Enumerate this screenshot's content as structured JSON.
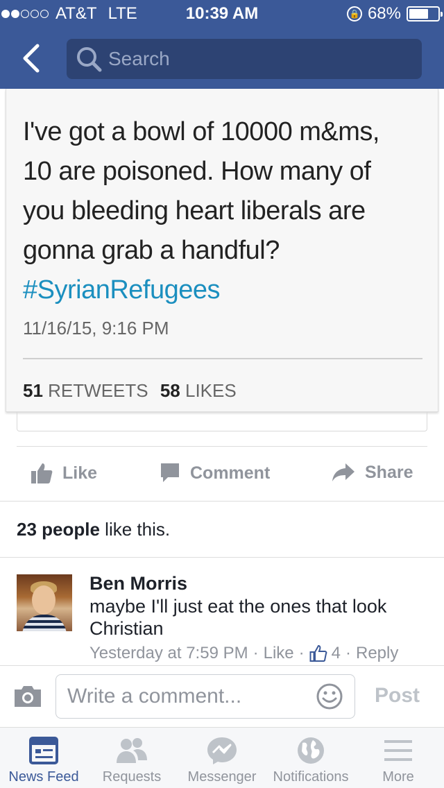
{
  "status_bar": {
    "carrier": "AT&T",
    "network": "LTE",
    "time": "10:39 AM",
    "battery": "68%",
    "signal_bars_filled": 2,
    "signal_bars_total": 5,
    "battery_level": 0.68
  },
  "header": {
    "search_placeholder": "Search"
  },
  "tweet": {
    "text_lines": [
      "I've got a bowl of 10000 m&ms,",
      "10 are poisoned.  How many of",
      "you bleeding heart liberals are",
      "gonna grab a handful?"
    ],
    "hashtag": "#SyrianRefugees",
    "date": "11/16/15, 9:16 PM",
    "retweets_count": "51",
    "retweets_label": "RETWEETS",
    "likes_count": "58",
    "likes_label": "LIKES"
  },
  "actions": {
    "like": "Like",
    "comment": "Comment",
    "share": "Share"
  },
  "likes_summary": {
    "count": "23 people",
    "suffix": " like this."
  },
  "comment": {
    "author": "Ben Morris",
    "text": "maybe I'll just eat the ones that look Christian",
    "time": "Yesterday at 7:59 PM",
    "like": "Like",
    "like_count": "4",
    "reply": "Reply"
  },
  "composer": {
    "placeholder": "Write a comment...",
    "post": "Post"
  },
  "tabs": [
    {
      "label": "News Feed",
      "icon": "news-feed-icon",
      "active": true
    },
    {
      "label": "Requests",
      "icon": "requests-icon",
      "active": false
    },
    {
      "label": "Messenger",
      "icon": "messenger-icon",
      "active": false
    },
    {
      "label": "Notifications",
      "icon": "globe-icon",
      "active": false
    },
    {
      "label": "More",
      "icon": "menu-icon",
      "active": false
    }
  ],
  "colors": {
    "brand": "#3b5998",
    "header_search_bg": "#2d4373",
    "hashtag": "#1b8fbf",
    "muted": "#90949c"
  }
}
